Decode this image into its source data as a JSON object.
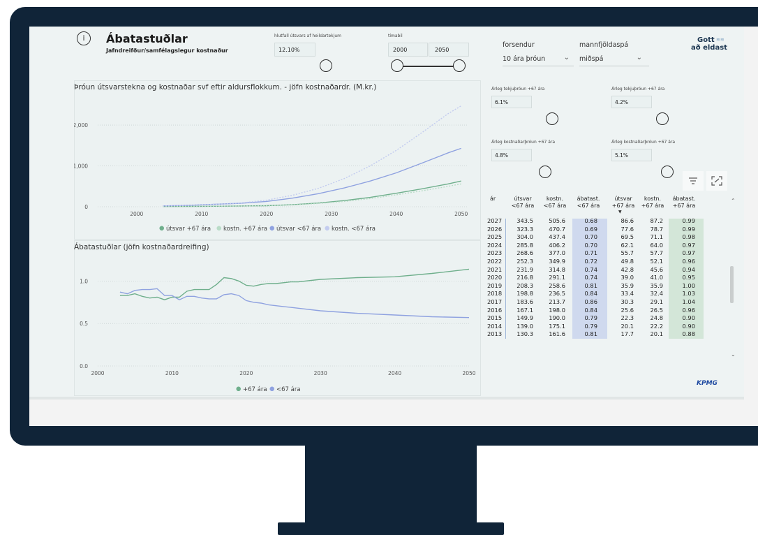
{
  "header": {
    "title": "Ábatastuðlar",
    "subtitle": "Jafndreifður/samfélagslegur kostnaður",
    "share_label": "hlutfall útsvars af heildartekjum",
    "share_value": "12.10%",
    "period_label": "tímabil",
    "period_from": "2000",
    "period_to": "2050"
  },
  "filters": {
    "forsendur_label": "forsendur",
    "forsendur_value": "10 ára þróun",
    "mannfjoldaspa_label": "mannfjöldaspá",
    "mannfjoldaspa_value": "miðspá"
  },
  "logo": {
    "line1": "Gott",
    "line2": "að eldast"
  },
  "params": {
    "tekju_a_label": "Árleg tekjuþróun +67 ára",
    "tekju_a_value": "6.1%",
    "tekju_b_label": "Árleg tekjuþróun +67 ára",
    "tekju_b_value": "4.2%",
    "kostn_a_label": "Árleg kostnaðarþróun +67 ára",
    "kostn_a_value": "4.8%",
    "kostn_b_label": "Árleg kostnaðarþróun +67 ára",
    "kostn_b_value": "5.1%"
  },
  "icons": {
    "info": "info-icon",
    "filter": "filter-icon",
    "focus": "focus-mode-icon",
    "sort": "sort-down-icon"
  },
  "colors": {
    "green": "#6faf8c",
    "green_light": "#b9dcc7",
    "blue": "#8fa2e0",
    "blue_light": "#c3ccef"
  },
  "chart_data": [
    {
      "type": "line",
      "title": "Þróun útsvarstekna og kostnaðar svf eftir aldursflokkum. - jöfn kostnaðardr. (M.kr.)",
      "x": [
        2004,
        2008,
        2012,
        2016,
        2020,
        2024,
        2028,
        2032,
        2036,
        2040,
        2044,
        2048,
        2050
      ],
      "x_ticks": [
        "2000",
        "2010",
        "2020",
        "2030",
        "2040",
        "2050"
      ],
      "y_ticks": [
        "0",
        "1,000",
        "2,000"
      ],
      "xlim": [
        1994,
        2051
      ],
      "ylim": [
        0,
        2600
      ],
      "series": [
        {
          "name": "útsvar +67 ára",
          "color": "#6faf8c",
          "dash": false,
          "values": [
            5,
            8,
            12,
            18,
            25,
            50,
            90,
            150,
            230,
            330,
            440,
            560,
            630
          ]
        },
        {
          "name": "kostn. +67 ára",
          "color": "#b9dcc7",
          "dash": true,
          "values": [
            5,
            8,
            12,
            18,
            25,
            45,
            80,
            130,
            200,
            290,
            390,
            500,
            560
          ]
        },
        {
          "name": "útsvar <67 ára",
          "color": "#8fa2e0",
          "dash": false,
          "values": [
            20,
            35,
            60,
            85,
            130,
            210,
            320,
            460,
            630,
            830,
            1070,
            1320,
            1430
          ]
        },
        {
          "name": "kostn. <67 ára",
          "color": "#c3ccef",
          "dash": true,
          "values": [
            20,
            35,
            60,
            90,
            160,
            280,
            450,
            690,
            1000,
            1380,
            1820,
            2280,
            2470
          ]
        }
      ]
    },
    {
      "type": "line",
      "title": "Ábatastuðlar (jöfn kostnaðardreifing)",
      "x": [
        2003,
        2004,
        2005,
        2006,
        2007,
        2008,
        2009,
        2010,
        2011,
        2012,
        2013,
        2014,
        2015,
        2016,
        2017,
        2018,
        2019,
        2020,
        2021,
        2022,
        2023,
        2024,
        2025,
        2026,
        2027,
        2030,
        2035,
        2040,
        2045,
        2050
      ],
      "x_ticks": [
        "2000",
        "2010",
        "2020",
        "2030",
        "2040",
        "2050"
      ],
      "y_ticks": [
        "0.0",
        "0.5",
        "1.0"
      ],
      "xlim": [
        2000,
        2050
      ],
      "ylim": [
        0,
        1.25
      ],
      "series": [
        {
          "name": "+67 ára",
          "color": "#6faf8c",
          "values": [
            0.83,
            0.83,
            0.85,
            0.82,
            0.8,
            0.81,
            0.78,
            0.81,
            0.81,
            0.88,
            0.9,
            0.9,
            0.9,
            0.96,
            1.04,
            1.03,
            1.0,
            0.95,
            0.94,
            0.96,
            0.97,
            0.97,
            0.98,
            0.99,
            0.99,
            1.02,
            1.04,
            1.05,
            1.09,
            1.14
          ]
        },
        {
          "name": "<67 ára",
          "color": "#8fa2e0",
          "values": [
            0.87,
            0.85,
            0.89,
            0.9,
            0.9,
            0.91,
            0.83,
            0.83,
            0.78,
            0.82,
            0.82,
            0.8,
            0.79,
            0.79,
            0.84,
            0.85,
            0.83,
            0.77,
            0.75,
            0.74,
            0.72,
            0.71,
            0.7,
            0.69,
            0.68,
            0.65,
            0.62,
            0.6,
            0.58,
            0.57
          ]
        }
      ]
    }
  ],
  "table": {
    "columns": [
      "ár",
      "útsvar <67 ára",
      "kostn. <67 ára",
      "ábatast. <67 ára",
      "útsvar +67 ára",
      "kostn. +67 ára",
      "ábatast. +67 ára"
    ],
    "col_top": [
      "ár",
      "útsvar",
      "kostn.",
      "ábatast.",
      "útsvar",
      "kostn.",
      "ábatast."
    ],
    "col_bottom": [
      "",
      "<67 ára",
      "<67 ára",
      "<67 ára",
      "+67 ára",
      "+67 ára",
      "+67 ára"
    ],
    "rows": [
      [
        "2027",
        "343.5",
        "505.6",
        "0.68",
        "86.6",
        "87.2",
        "0.99"
      ],
      [
        "2026",
        "323.3",
        "470.7",
        "0.69",
        "77.6",
        "78.7",
        "0.99"
      ],
      [
        "2025",
        "304.0",
        "437.4",
        "0.70",
        "69.5",
        "71.1",
        "0.98"
      ],
      [
        "2024",
        "285.8",
        "406.2",
        "0.70",
        "62.1",
        "64.0",
        "0.97"
      ],
      [
        "2023",
        "268.6",
        "377.0",
        "0.71",
        "55.7",
        "57.7",
        "0.97"
      ],
      [
        "2022",
        "252.3",
        "349.9",
        "0.72",
        "49.8",
        "52.1",
        "0.96"
      ],
      [
        "2021",
        "231.9",
        "314.8",
        "0.74",
        "42.8",
        "45.6",
        "0.94"
      ],
      [
        "2020",
        "216.8",
        "291.1",
        "0.74",
        "39.0",
        "41.0",
        "0.95"
      ],
      [
        "2019",
        "208.3",
        "258.6",
        "0.81",
        "35.9",
        "35.9",
        "1.00"
      ],
      [
        "2018",
        "198.8",
        "236.5",
        "0.84",
        "33.4",
        "32.4",
        "1.03"
      ],
      [
        "2017",
        "183.6",
        "213.7",
        "0.86",
        "30.3",
        "29.1",
        "1.04"
      ],
      [
        "2016",
        "167.1",
        "198.0",
        "0.84",
        "25.6",
        "26.5",
        "0.96"
      ],
      [
        "2015",
        "149.9",
        "190.0",
        "0.79",
        "22.3",
        "24.8",
        "0.90"
      ],
      [
        "2014",
        "139.0",
        "175.1",
        "0.79",
        "20.1",
        "22.2",
        "0.90"
      ],
      [
        "2013",
        "130.3",
        "161.6",
        "0.81",
        "17.7",
        "20.1",
        "0.88"
      ]
    ]
  },
  "footer_logo": "KPMG"
}
